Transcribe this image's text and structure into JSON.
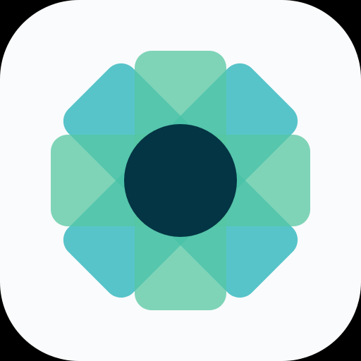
{
  "app_icon": {
    "icon_name": "flower-app-icon",
    "colors": {
      "tile_background": "#fafbfc",
      "page_background": "#000000",
      "vertical_petal": "#56c7a2",
      "horizontal_petal": "#56c7a2",
      "diagonal_petal": "#20b2b8",
      "center_circle": "#043544"
    }
  }
}
